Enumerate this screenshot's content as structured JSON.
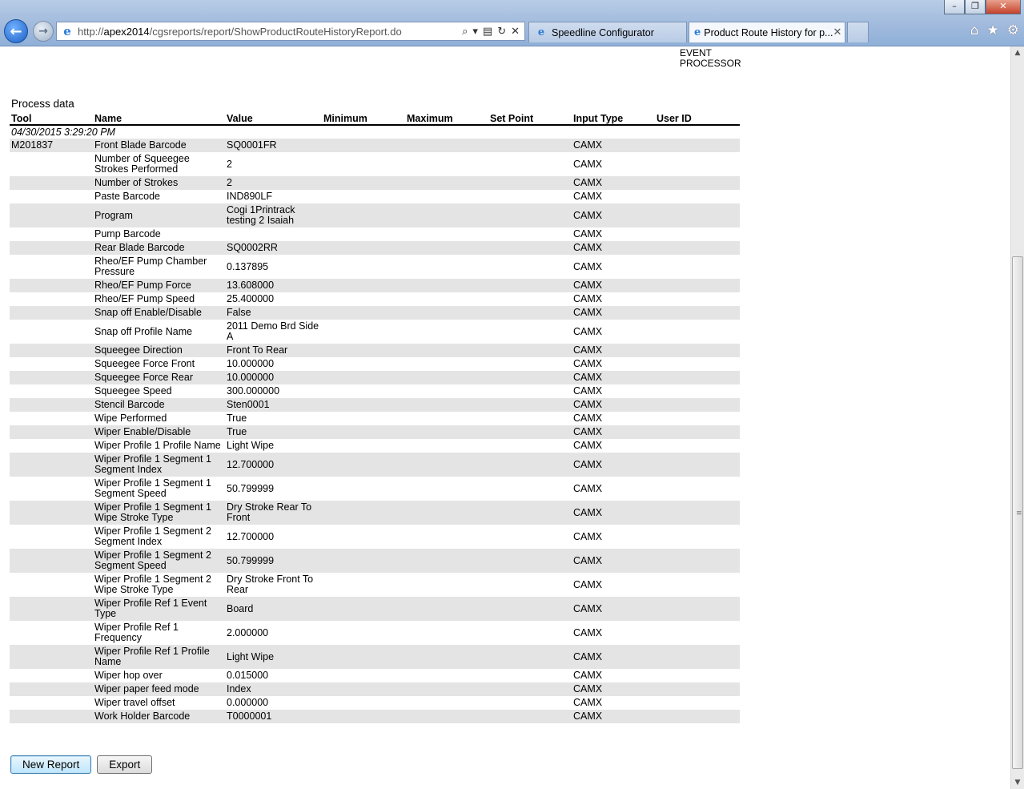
{
  "browser": {
    "url_prefix": "http://",
    "url_host": "apex2014",
    "url_path": "/cgsreports/report/ShowProductRouteHistoryReport.do",
    "tabs": [
      {
        "label": "Speedline Configurator"
      },
      {
        "label": "Product Route History for p..."
      }
    ]
  },
  "page": {
    "top_stub_line1": "EVENT",
    "top_stub_line2": "PROCESSOR",
    "section_title": "Process data",
    "columns": [
      "Tool",
      "Name",
      "Value",
      "Minimum",
      "Maximum",
      "Set Point",
      "Input Type",
      "User ID"
    ],
    "date_row": "04/30/2015 3:29:20 PM",
    "rows": [
      {
        "tool": "M201837",
        "name": "Front Blade Barcode",
        "value": "SQ0001FR",
        "input": "CAMX",
        "tall": false
      },
      {
        "tool": "",
        "name": "Number of Squeegee Strokes Performed",
        "value": "2",
        "input": "CAMX",
        "tall": true
      },
      {
        "tool": "",
        "name": "Number of Strokes",
        "value": "2",
        "input": "CAMX",
        "tall": false
      },
      {
        "tool": "",
        "name": "Paste Barcode",
        "value": "IND890LF",
        "input": "CAMX",
        "tall": false
      },
      {
        "tool": "",
        "name": "Program",
        "value": "Cogi 1Printrack testing 2 Isaiah",
        "input": "CAMX",
        "tall": true
      },
      {
        "tool": "",
        "name": "Pump Barcode",
        "value": "",
        "input": "CAMX",
        "tall": false
      },
      {
        "tool": "",
        "name": "Rear Blade Barcode",
        "value": "SQ0002RR",
        "input": "CAMX",
        "tall": false
      },
      {
        "tool": "",
        "name": "Rheo/EF Pump Chamber Pressure",
        "value": "0.137895",
        "input": "CAMX",
        "tall": true
      },
      {
        "tool": "",
        "name": "Rheo/EF Pump Force",
        "value": "13.608000",
        "input": "CAMX",
        "tall": false
      },
      {
        "tool": "",
        "name": "Rheo/EF Pump Speed",
        "value": "25.400000",
        "input": "CAMX",
        "tall": false
      },
      {
        "tool": "",
        "name": "Snap off Enable/Disable",
        "value": "False",
        "input": "CAMX",
        "tall": false
      },
      {
        "tool": "",
        "name": "Snap off Profile Name",
        "value": "2011 Demo Brd Side A",
        "input": "CAMX",
        "tall": true
      },
      {
        "tool": "",
        "name": "Squeegee Direction",
        "value": "Front To Rear",
        "input": "CAMX",
        "tall": false
      },
      {
        "tool": "",
        "name": "Squeegee Force Front",
        "value": "10.000000",
        "input": "CAMX",
        "tall": false
      },
      {
        "tool": "",
        "name": "Squeegee Force Rear",
        "value": "10.000000",
        "input": "CAMX",
        "tall": false
      },
      {
        "tool": "",
        "name": "Squeegee Speed",
        "value": "300.000000",
        "input": "CAMX",
        "tall": false
      },
      {
        "tool": "",
        "name": "Stencil Barcode",
        "value": "Sten0001",
        "input": "CAMX",
        "tall": false
      },
      {
        "tool": "",
        "name": "Wipe Performed",
        "value": "True",
        "input": "CAMX",
        "tall": false
      },
      {
        "tool": "",
        "name": "Wiper Enable/Disable",
        "value": "True",
        "input": "CAMX",
        "tall": false
      },
      {
        "tool": "",
        "name": "Wiper Profile 1 Profile Name",
        "value": "Light Wipe",
        "input": "CAMX",
        "tall": false
      },
      {
        "tool": "",
        "name": "Wiper Profile 1 Segment 1 Segment Index",
        "value": "12.700000",
        "input": "CAMX",
        "tall": true
      },
      {
        "tool": "",
        "name": "Wiper Profile 1 Segment 1 Segment Speed",
        "value": "50.799999",
        "input": "CAMX",
        "tall": true
      },
      {
        "tool": "",
        "name": "Wiper Profile 1 Segment 1 Wipe Stroke Type",
        "value": "Dry Stroke Rear To Front",
        "input": "CAMX",
        "tall": true
      },
      {
        "tool": "",
        "name": "Wiper Profile 1 Segment 2 Segment Index",
        "value": "12.700000",
        "input": "CAMX",
        "tall": true
      },
      {
        "tool": "",
        "name": "Wiper Profile 1 Segment 2 Segment Speed",
        "value": "50.799999",
        "input": "CAMX",
        "tall": true
      },
      {
        "tool": "",
        "name": "Wiper Profile 1 Segment 2 Wipe Stroke Type",
        "value": "Dry Stroke Front To Rear",
        "input": "CAMX",
        "tall": true
      },
      {
        "tool": "",
        "name": "Wiper Profile Ref 1 Event Type",
        "value": "Board",
        "input": "CAMX",
        "tall": true
      },
      {
        "tool": "",
        "name": "Wiper Profile Ref 1 Frequency",
        "value": "2.000000",
        "input": "CAMX",
        "tall": true
      },
      {
        "tool": "",
        "name": "Wiper Profile Ref 1 Profile Name",
        "value": "Light Wipe",
        "input": "CAMX",
        "tall": true
      },
      {
        "tool": "",
        "name": "Wiper hop over",
        "value": "0.015000",
        "input": "CAMX",
        "tall": false
      },
      {
        "tool": "",
        "name": "Wiper paper feed mode",
        "value": "Index",
        "input": "CAMX",
        "tall": false
      },
      {
        "tool": "",
        "name": "Wiper travel offset",
        "value": "0.000000",
        "input": "CAMX",
        "tall": false
      },
      {
        "tool": "",
        "name": "Work Holder Barcode",
        "value": "T0000001",
        "input": "CAMX",
        "tall": false
      }
    ],
    "buttons": {
      "new_report": "New Report",
      "export": "Export"
    }
  },
  "icons": {
    "back": "back-arrow-icon",
    "forward": "forward-arrow-icon",
    "home": "home-icon",
    "favorites": "star-icon",
    "tools": "gear-icon"
  },
  "colors": {
    "row_alt": "#e4e4e4",
    "chrome": "#9fb9dc"
  }
}
